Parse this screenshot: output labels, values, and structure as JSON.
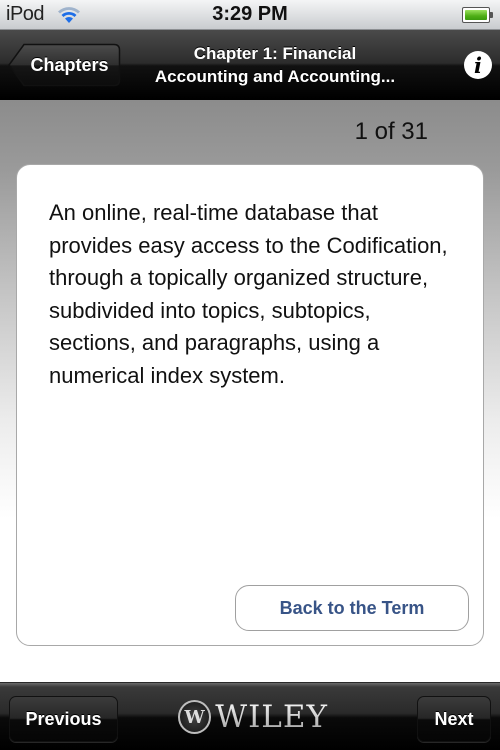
{
  "status_bar": {
    "carrier": "iPod",
    "time": "3:29 PM",
    "wifi_icon": "wifi-icon",
    "battery_icon": "battery-full-icon",
    "battery_level": 1.0,
    "battery_color": "#4fae16"
  },
  "nav_bar": {
    "back_label": "Chapters",
    "title_line1": "Chapter 1: Financial",
    "title_line2": "Accounting and Accounting...",
    "info_glyph": "i",
    "info_icon": "info-icon"
  },
  "content": {
    "page_counter": "1 of 31",
    "definition": "An online, real-time database that provides easy access to the Codification, through a topically organized structure, subdivided into topics, subtopics, sections, and paragraphs, using a numerical index system.",
    "back_to_term_label": "Back to the Term",
    "link_color": "#385487"
  },
  "toolbar": {
    "previous_label": "Previous",
    "next_label": "Next",
    "logo_text": "WILEY",
    "logo_mark": "W"
  }
}
